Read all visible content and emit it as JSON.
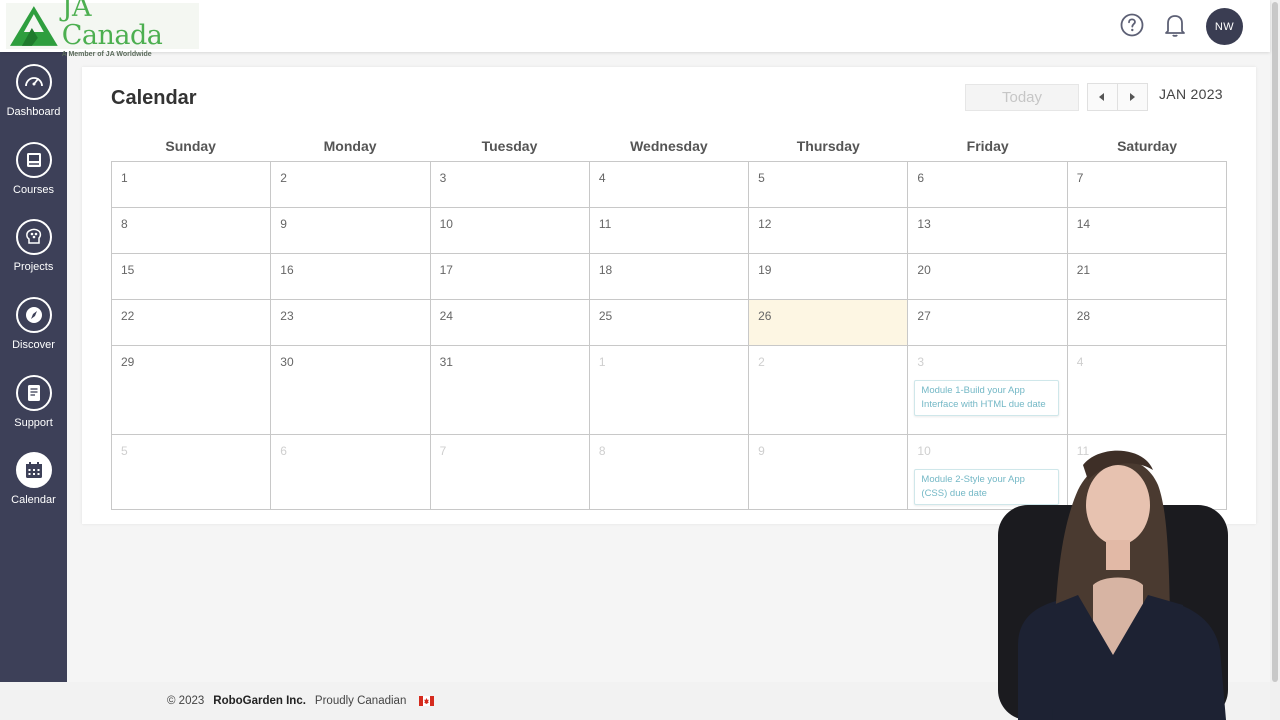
{
  "header": {
    "logo_title": "JA Canada",
    "logo_subtitle": "A Member of JA Worldwide",
    "avatar_initials": "NW"
  },
  "sidebar": {
    "items": [
      {
        "label": "Dashboard",
        "icon": "gauge-icon"
      },
      {
        "label": "Courses",
        "icon": "book-icon"
      },
      {
        "label": "Projects",
        "icon": "brain-icon"
      },
      {
        "label": "Discover",
        "icon": "compass-icon"
      },
      {
        "label": "Support",
        "icon": "document-icon"
      },
      {
        "label": "Calendar",
        "icon": "calendar-icon",
        "active": true
      }
    ]
  },
  "calendar": {
    "title": "Calendar",
    "today_label": "Today",
    "month_label": "JAN 2023",
    "weekdays": [
      "Sunday",
      "Monday",
      "Tuesday",
      "Wednesday",
      "Thursday",
      "Friday",
      "Saturday"
    ],
    "weeks": [
      [
        "1",
        "2",
        "3",
        "4",
        "5",
        "6",
        "7"
      ],
      [
        "8",
        "9",
        "10",
        "11",
        "12",
        "13",
        "14"
      ],
      [
        "15",
        "16",
        "17",
        "18",
        "19",
        "20",
        "21"
      ],
      [
        "22",
        "23",
        "24",
        "25",
        "26",
        "27",
        "28"
      ],
      [
        "29",
        "30",
        "31",
        "1",
        "2",
        "3",
        "4"
      ],
      [
        "5",
        "6",
        "7",
        "8",
        "9",
        "10",
        "11"
      ]
    ],
    "events": {
      "module1": "Module 1-Build your App Interface with HTML due date",
      "module2": "Module 2-Style your App (CSS) due date"
    }
  },
  "footer": {
    "copyright": "© 2023",
    "company": "RoboGarden Inc.",
    "tagline": "Proudly Canadian"
  },
  "colors": {
    "sidebar_bg": "#3d4058",
    "logo_green": "#4caf50",
    "today_highlight": "#fdf6e3",
    "event_text": "#74b8c6",
    "flag_red": "#d52b1e"
  }
}
